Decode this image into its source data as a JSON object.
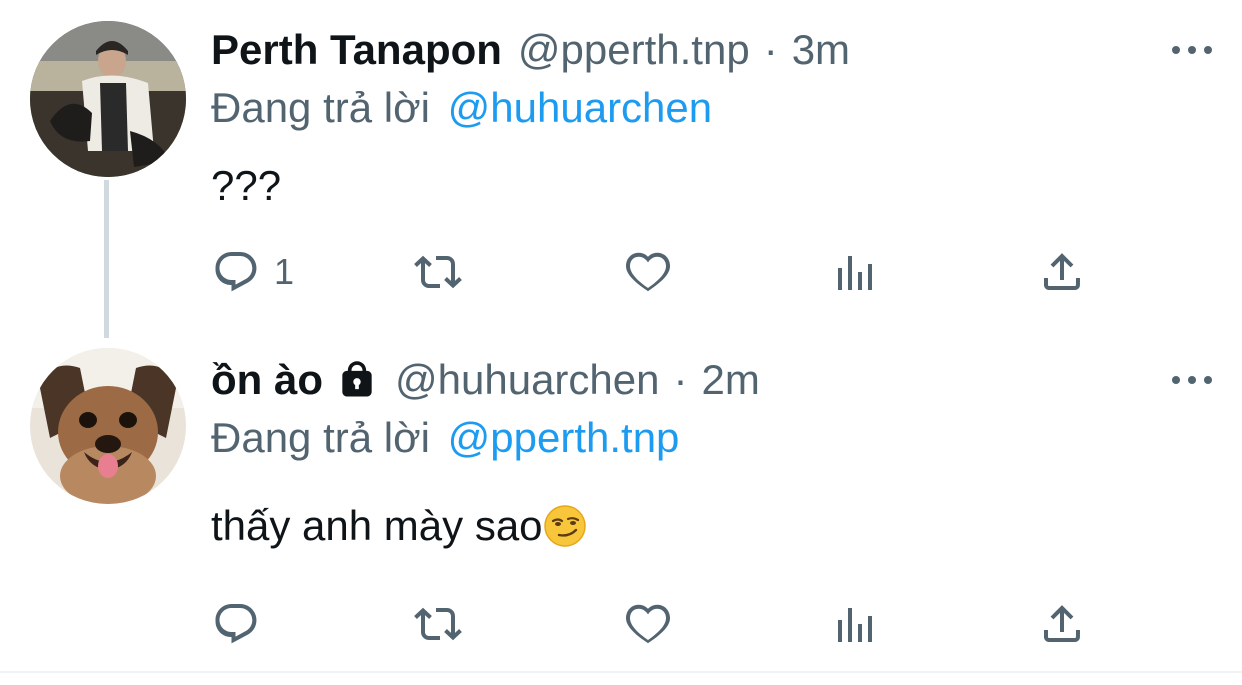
{
  "tweets": [
    {
      "author_name": "Perth Tanapon",
      "author_handle": "@pperth.tnp",
      "separator": "·",
      "time": "3m",
      "replying_prefix": "Đang trả lời",
      "replying_to": "@huhuarchen",
      "text": "???",
      "reply_count": "1",
      "locked": false
    },
    {
      "author_name": "ồn ào",
      "author_handle": "@huhuarchen",
      "separator": "·",
      "time": "2m",
      "replying_prefix": "Đang trả lời",
      "replying_to": "@pperth.tnp",
      "text": "thấy anh mày sao",
      "reply_count": "",
      "locked": true,
      "emoji": "smirking-face"
    }
  ],
  "icons": {
    "reply": "reply-icon",
    "retweet": "retweet-icon",
    "like": "like-icon",
    "views": "views-icon",
    "share": "share-icon",
    "more": "more-icon",
    "lock": "lock-icon"
  },
  "colors": {
    "text": "#0f1419",
    "secondary": "#536471",
    "mention": "#1d9bf0",
    "thread_line": "#cfd9de"
  }
}
